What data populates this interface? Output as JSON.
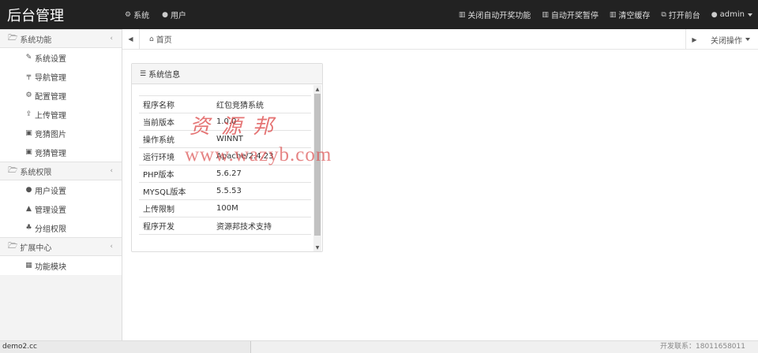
{
  "brand": "后台管理",
  "topnav": [
    {
      "icon": "gear-icon",
      "glyph": "⚙",
      "label": "系统"
    },
    {
      "icon": "user-icon",
      "glyph": "●",
      "label": "用户"
    }
  ],
  "topright": [
    {
      "icon": "trash-icon",
      "glyph": "▥",
      "label": "关闭自动开奖功能"
    },
    {
      "icon": "trash-icon",
      "glyph": "▥",
      "label": "自动开奖暂停"
    },
    {
      "icon": "trash-icon",
      "glyph": "▥",
      "label": "清空缓存"
    },
    {
      "icon": "external-link-icon",
      "glyph": "⧉",
      "label": "打开前台"
    },
    {
      "icon": "user-icon",
      "glyph": "●",
      "label": "admin"
    }
  ],
  "sidebar": {
    "groups": [
      {
        "label": "系统功能",
        "items": [
          {
            "icon": "wrench-icon",
            "glyph": "✎",
            "label": "系统设置"
          },
          {
            "icon": "signpost-icon",
            "glyph": "╤",
            "label": "导航管理"
          },
          {
            "icon": "gears-icon",
            "glyph": "⚙",
            "label": "配置管理"
          },
          {
            "icon": "upload-icon",
            "glyph": "⇪",
            "label": "上传管理"
          },
          {
            "icon": "image-icon",
            "glyph": "▣",
            "label": "竞猜图片"
          },
          {
            "icon": "image-icon",
            "glyph": "▣",
            "label": "竞猜管理"
          }
        ]
      },
      {
        "label": "系统权限",
        "items": [
          {
            "icon": "user-icon",
            "glyph": "●",
            "label": "用户设置"
          },
          {
            "icon": "lock-icon",
            "glyph": "▲",
            "label": "管理设置"
          },
          {
            "icon": "sitemap-icon",
            "glyph": "♣",
            "label": "分组权限"
          }
        ]
      },
      {
        "label": "扩展中心",
        "items": [
          {
            "icon": "grid-icon",
            "glyph": "▦",
            "label": "功能模块"
          }
        ]
      }
    ]
  },
  "breadcrumb": {
    "home": "首页",
    "close_ops": "关闭操作"
  },
  "panel": {
    "title": "系统信息",
    "rows": [
      {
        "key": "程序名称",
        "value": "红包竞猜系统"
      },
      {
        "key": "当前版本",
        "value": "1.0.0"
      },
      {
        "key": "操作系统",
        "value": "WINNT"
      },
      {
        "key": "运行环境",
        "value": "Apache/2.4.23"
      },
      {
        "key": "PHP版本",
        "value": "5.6.27"
      },
      {
        "key": "MYSQL版本",
        "value": "5.5.53"
      },
      {
        "key": "上传限制",
        "value": "100M"
      },
      {
        "key": "程序开发",
        "value": "资源邦技术支持"
      }
    ]
  },
  "watermark": {
    "cn": "资源邦",
    "url": "www.wazyb.com"
  },
  "status": {
    "url": "demo2.cc",
    "contact": "开发联系：18011658011"
  },
  "colors": {
    "topbar": "#222222",
    "sidebar": "#f3f3f3",
    "watermark": "#dc4646"
  }
}
